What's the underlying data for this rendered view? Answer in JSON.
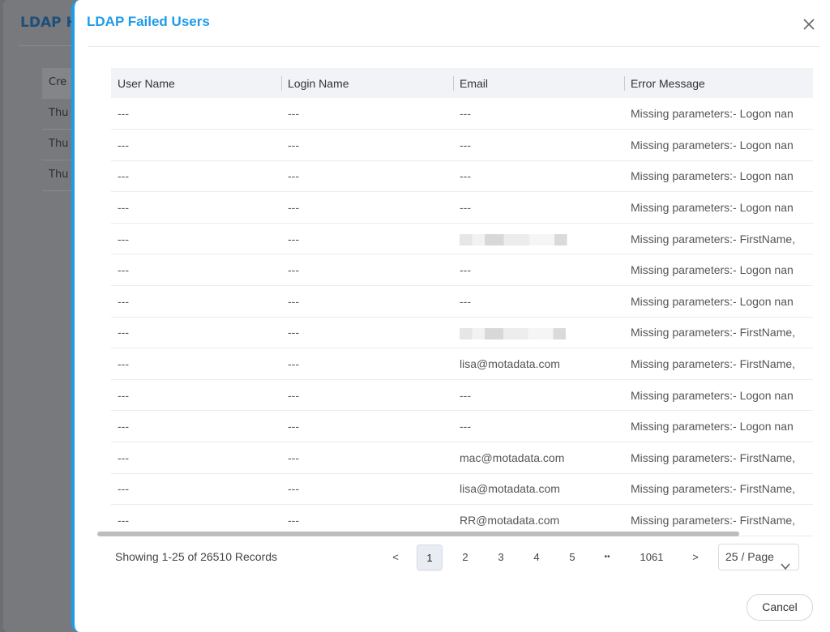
{
  "background": {
    "title": "LDAP H",
    "column_header": "Cre",
    "rows": [
      "Thu",
      "Thu",
      "Thu"
    ]
  },
  "modal": {
    "title": "LDAP Failed Users",
    "close_icon": "close-icon"
  },
  "table": {
    "columns": [
      "User Name",
      "Login Name",
      "Email",
      "Error Message"
    ],
    "rows": [
      {
        "user": "---",
        "login": "---",
        "email": "---",
        "error": "Missing parameters:- Logon nan"
      },
      {
        "user": "---",
        "login": "---",
        "email": "---",
        "error": "Missing parameters:- Logon nan"
      },
      {
        "user": "---",
        "login": "---",
        "email": "---",
        "error": "Missing parameters:- Logon nan"
      },
      {
        "user": "---",
        "login": "---",
        "email": "---",
        "error": "Missing parameters:- Logon nan"
      },
      {
        "user": "---",
        "login": "---",
        "email": "",
        "error": "Missing parameters:- FirstName,"
      },
      {
        "user": "---",
        "login": "---",
        "email": "---",
        "error": "Missing parameters:- Logon nan"
      },
      {
        "user": "---",
        "login": "---",
        "email": "---",
        "error": "Missing parameters:- Logon nan"
      },
      {
        "user": "---",
        "login": "---",
        "email": "",
        "error": "Missing parameters:- FirstName,"
      },
      {
        "user": "---",
        "login": "---",
        "email": "lisa@motadata.com",
        "error": "Missing parameters:- FirstName,"
      },
      {
        "user": "---",
        "login": "---",
        "email": "---",
        "error": "Missing parameters:- Logon nan"
      },
      {
        "user": "---",
        "login": "---",
        "email": "---",
        "error": "Missing parameters:- Logon nan"
      },
      {
        "user": "---",
        "login": "---",
        "email": "mac@motadata.com",
        "error": "Missing parameters:- FirstName,"
      },
      {
        "user": "---",
        "login": "---",
        "email": "lisa@motadata.com",
        "error": "Missing parameters:- FirstName,"
      },
      {
        "user": "---",
        "login": "---",
        "email": "RR@motadata.com",
        "error": "Missing parameters:- FirstName,"
      }
    ]
  },
  "pagination": {
    "summary": "Showing 1-25 of 26510 Records",
    "prev": "<",
    "pages": [
      "1",
      "2",
      "3",
      "4",
      "5"
    ],
    "ellipsis": "••",
    "last": "1061",
    "next": ">",
    "active_page": "1",
    "page_size": "25 / Page"
  },
  "footer": {
    "cancel_label": "Cancel"
  },
  "colors": {
    "accent": "#1e9be9",
    "header_bg": "#f1f3f7"
  }
}
